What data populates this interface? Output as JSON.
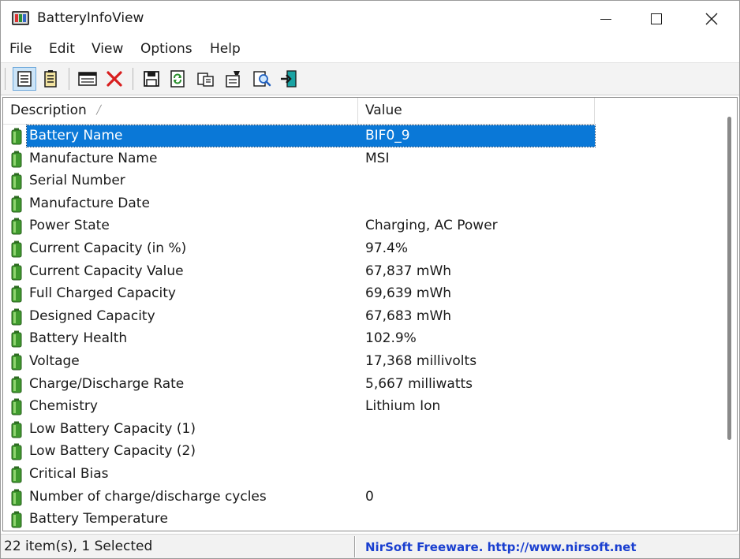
{
  "window": {
    "title": "BatteryInfoView",
    "icon": "battery-app-icon",
    "controls": [
      "minimize-icon",
      "maximize-icon",
      "close-icon"
    ]
  },
  "menu": {
    "file": "File",
    "edit": "Edit",
    "view": "View",
    "options": "Options",
    "help": "Help"
  },
  "toolbar": {
    "buttons": [
      "battery-info-view-icon",
      "battery-log-view-icon",
      "html-report-icon",
      "delete-icon",
      "save-icon",
      "refresh-icon",
      "copy-icon",
      "properties-icon",
      "find-icon",
      "exit-icon"
    ]
  },
  "list": {
    "columns": {
      "description": "Description",
      "value": "Value"
    },
    "rows": [
      {
        "description": "Battery Name",
        "value": "BIF0_9"
      },
      {
        "description": "Manufacture Name",
        "value": "MSI"
      },
      {
        "description": "Serial Number",
        "value": ""
      },
      {
        "description": "Manufacture Date",
        "value": ""
      },
      {
        "description": "Power State",
        "value": "Charging, AC Power"
      },
      {
        "description": "Current Capacity (in %)",
        "value": "97.4%"
      },
      {
        "description": "Current Capacity Value",
        "value": "67,837 mWh"
      },
      {
        "description": "Full Charged Capacity",
        "value": "69,639 mWh"
      },
      {
        "description": "Designed Capacity",
        "value": "67,683 mWh"
      },
      {
        "description": "Battery Health",
        "value": "102.9%"
      },
      {
        "description": "Voltage",
        "value": "17,368 millivolts"
      },
      {
        "description": "Charge/Discharge Rate",
        "value": "5,667 milliwatts"
      },
      {
        "description": "Chemistry",
        "value": "Lithium Ion"
      },
      {
        "description": "Low Battery Capacity (1)",
        "value": ""
      },
      {
        "description": "Low Battery Capacity (2)",
        "value": ""
      },
      {
        "description": "Critical Bias",
        "value": ""
      },
      {
        "description": "Number of charge/discharge cycles",
        "value": "0"
      },
      {
        "description": "Battery Temperature",
        "value": ""
      }
    ],
    "selected_index": 0
  },
  "status": {
    "items": "22 item(s), 1 Selected",
    "link": "NirSoft Freeware.  http://www.nirsoft.net"
  },
  "colors": {
    "selection": "#0a78d7",
    "battery": "#3f9a2e",
    "link": "#1a3fd0"
  }
}
